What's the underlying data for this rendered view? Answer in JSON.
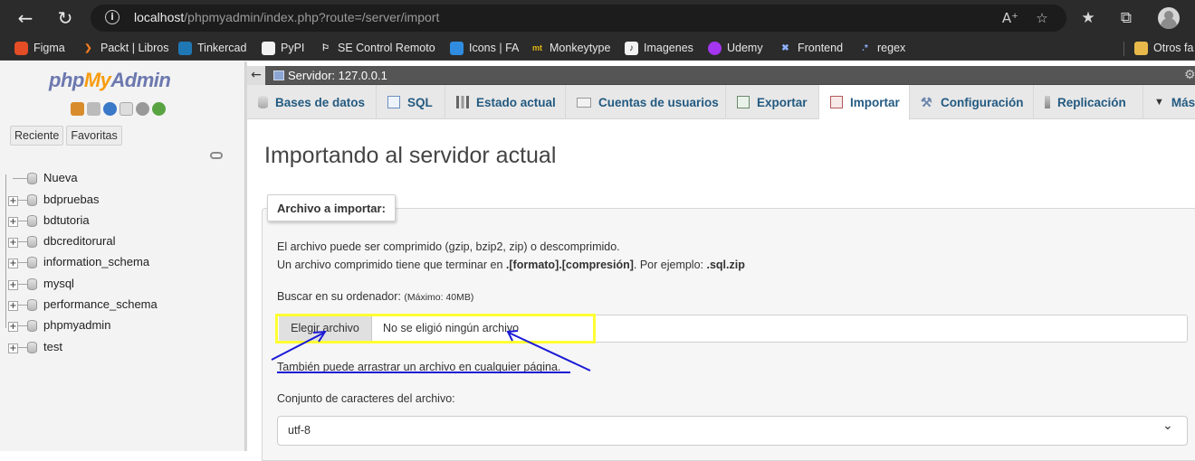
{
  "browser": {
    "url_host": "localhost",
    "url_path": "/phpmyadmin/index.php?route=/server/import",
    "bookmarks": [
      {
        "label": "Figma",
        "icon": "figma-icon",
        "color": "#e44d26"
      },
      {
        "label": "Packt | Libros",
        "icon": "packt-icon",
        "color": "#f47c20"
      },
      {
        "label": "Tinkercad",
        "icon": "tinkercad-icon",
        "color": "#1f77b4"
      },
      {
        "label": "PyPI",
        "icon": "pypi-icon",
        "color": "#ffffff"
      },
      {
        "label": "SE Control Remoto",
        "icon": "se-icon",
        "color": "#2b2b2b"
      },
      {
        "label": "Icons | FA",
        "icon": "fa-icon",
        "color": "#2f8ce0"
      },
      {
        "label": "Monkeytype",
        "icon": "monkeytype-icon",
        "color": "#e2b714"
      },
      {
        "label": "Imagenes",
        "icon": "images-icon",
        "color": "#ffffff"
      },
      {
        "label": "Udemy",
        "icon": "udemy-icon",
        "color": "#a435f0"
      },
      {
        "label": "Frontend",
        "icon": "frontend-icon",
        "color": "#4f7bd6"
      },
      {
        "label": "regex",
        "icon": "regex-icon",
        "color": "#5b8def"
      }
    ],
    "bookmarks_more": "Otros fa"
  },
  "sidebar": {
    "logo_php": "php",
    "logo_my": "My",
    "logo_admin": "Admin",
    "btn_recent": "Reciente",
    "btn_favorites": "Favoritas",
    "items": [
      {
        "label": "Nueva"
      },
      {
        "label": "bdpruebas"
      },
      {
        "label": "bdtutoria"
      },
      {
        "label": "dbcreditorural"
      },
      {
        "label": "information_schema"
      },
      {
        "label": "mysql"
      },
      {
        "label": "performance_schema"
      },
      {
        "label": "phpmyadmin"
      },
      {
        "label": "test"
      }
    ]
  },
  "header": {
    "server_label": "Servidor: 127.0.0.1"
  },
  "tabs": [
    {
      "label": "Bases de datos",
      "icon": "database-icon"
    },
    {
      "label": "SQL",
      "icon": "sql-icon"
    },
    {
      "label": "Estado actual",
      "icon": "status-icon"
    },
    {
      "label": "Cuentas de usuarios",
      "icon": "users-icon"
    },
    {
      "label": "Exportar",
      "icon": "export-icon"
    },
    {
      "label": "Importar",
      "icon": "import-icon"
    },
    {
      "label": "Configuración",
      "icon": "wrench-icon"
    },
    {
      "label": "Replicación",
      "icon": "replication-icon"
    },
    {
      "label": "Más",
      "icon": "chevron-down-icon"
    }
  ],
  "main": {
    "title": "Importando al servidor actual",
    "legend": "Archivo a importar:",
    "line1": "El archivo puede ser comprimido (gzip, bzip2, zip) o descomprimido.",
    "line2_a": "Un archivo comprimido tiene que terminar en ",
    "line2_b": ".[formato].[compresión]",
    "line2_c": ". Por ejemplo: ",
    "line2_d": ".sql.zip",
    "browse_label": "Buscar en su ordenador:",
    "browse_max": "(Máximo: 40MB)",
    "choose_button": "Elegir archivo",
    "no_file": "No se eligió ningún archivo",
    "drag_text": "También puede arrastrar un archivo en cualquier página.",
    "charset_label": "Conjunto de caracteres del archivo:",
    "charset_value": "utf-8"
  },
  "colors": {
    "highlight": "#ffff33",
    "annotation_arrow": "#1a1ad6"
  }
}
